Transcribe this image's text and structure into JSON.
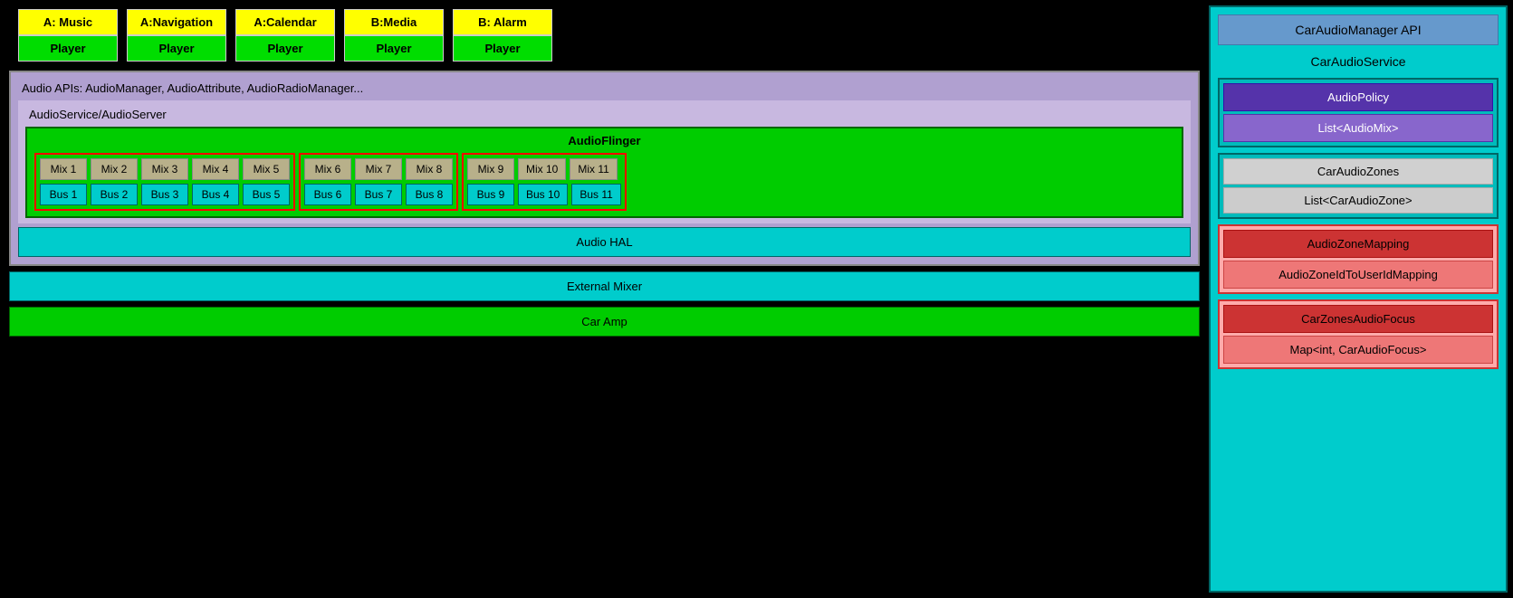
{
  "apps": [
    {
      "label": "A: Music",
      "player": "Player"
    },
    {
      "label": "A:Navigation",
      "player": "Player"
    },
    {
      "label": "A:Calendar",
      "player": "Player"
    },
    {
      "label": "B:Media",
      "player": "Player"
    },
    {
      "label": "B: Alarm",
      "player": "Player"
    }
  ],
  "stack": {
    "apis_label": "Audio APIs: AudioManager, AudioAttribute, AudioRadioManager...",
    "service_label": "AudioService/AudioServer",
    "audio_flinger": "AudioFlinger",
    "audio_hal": "Audio HAL",
    "external_mixer": "External Mixer",
    "car_amp": "Car Amp"
  },
  "zones": [
    {
      "mixes": [
        "Mix 1",
        "Mix 2",
        "Mix 3",
        "Mix 4",
        "Mix 5"
      ],
      "buses": [
        "Bus 1",
        "Bus 2",
        "Bus 3",
        "Bus 4",
        "Bus 5"
      ]
    },
    {
      "mixes": [
        "Mix 6",
        "Mix 7",
        "Mix 8"
      ],
      "buses": [
        "Bus 6",
        "Bus 7",
        "Bus 8"
      ]
    },
    {
      "mixes": [
        "Mix 9",
        "Mix 10",
        "Mix 11"
      ],
      "buses": [
        "Bus 9",
        "Bus 10",
        "Bus 11"
      ]
    }
  ],
  "right_panel": {
    "car_audio_manager_api": "CarAudioManager API",
    "car_audio_service": "CarAudioService",
    "audio_policy": "AudioPolicy",
    "list_audio_mix": "List<AudioMix>",
    "car_audio_zones": "CarAudioZones",
    "list_car_audio_zone": "List<CarAudioZone>",
    "audio_zone_mapping": "AudioZoneMapping",
    "audio_zone_id_to_user_id": "AudioZoneIdToUserIdMapping",
    "car_zones_audio_focus": "CarZonesAudioFocus",
    "map_car_audio_focus": "Map<int, CarAudioFocus>"
  }
}
